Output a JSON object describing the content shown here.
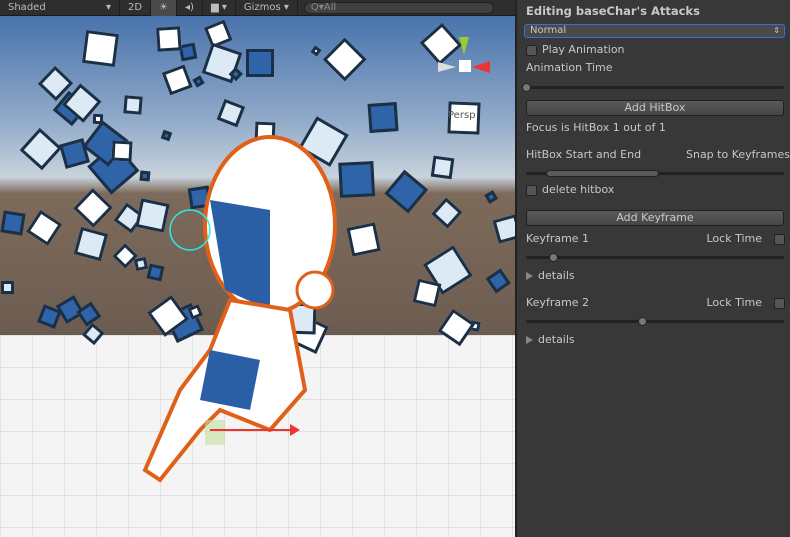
{
  "toolbar": {
    "shading_mode": "Shaded",
    "mode_2d": "2D",
    "gizmos_label": "Gizmos",
    "search_placeholder": "All",
    "icons": [
      "sun-icon",
      "audio-icon",
      "image-effects-icon"
    ]
  },
  "scene": {
    "camera_label": "Persp"
  },
  "inspector": {
    "title": "Editing baseChar's Attacks",
    "attack_select": "Normal",
    "play_animation_label": "Play Animation",
    "play_animation_checked": false,
    "animation_time_label": "Animation Time",
    "animation_time_value": 0,
    "add_hitbox_label": "Add HitBox",
    "focus_text": "Focus is HitBox 1 out of 1",
    "hitbox_range_label": "HitBox Start and End",
    "snap_label": "Snap to Keyframes",
    "hitbox_range": [
      0.08,
      0.52
    ],
    "delete_hitbox_label": "delete hitbox",
    "delete_hitbox_checked": false,
    "add_keyframe_label": "Add Keyframe",
    "keyframes": [
      {
        "label": "Keyframe 1",
        "lock_label": "Lock Time",
        "locked": false,
        "value": 0.09,
        "details_label": "details"
      },
      {
        "label": "Keyframe 2",
        "lock_label": "Lock Time",
        "locked": false,
        "value": 0.44,
        "details_label": "details"
      }
    ]
  }
}
